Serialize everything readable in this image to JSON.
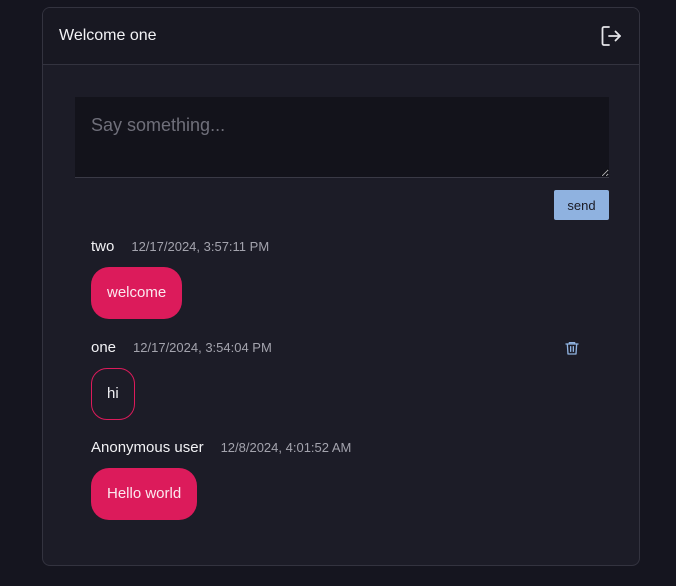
{
  "header": {
    "title": "Welcome one",
    "logout_icon": "logout-icon"
  },
  "composer": {
    "placeholder": "Say something...",
    "value": "",
    "send_label": "send"
  },
  "messages": [
    {
      "author": "two",
      "time": "12/17/2024, 3:57:11 PM",
      "text": "welcome",
      "style": "filled",
      "deletable": false
    },
    {
      "author": "one",
      "time": "12/17/2024, 3:54:04 PM",
      "text": "hi",
      "style": "outlined",
      "deletable": true,
      "delete_icon": "trash-icon"
    },
    {
      "author": "Anonymous user",
      "time": "12/8/2024, 4:01:52 AM",
      "text": "Hello world",
      "style": "filled",
      "deletable": false
    }
  ],
  "colors": {
    "accent": "#dc1b5b",
    "send_button": "#8fb2e0",
    "background": "#15151f",
    "card": "#1c1c27"
  }
}
